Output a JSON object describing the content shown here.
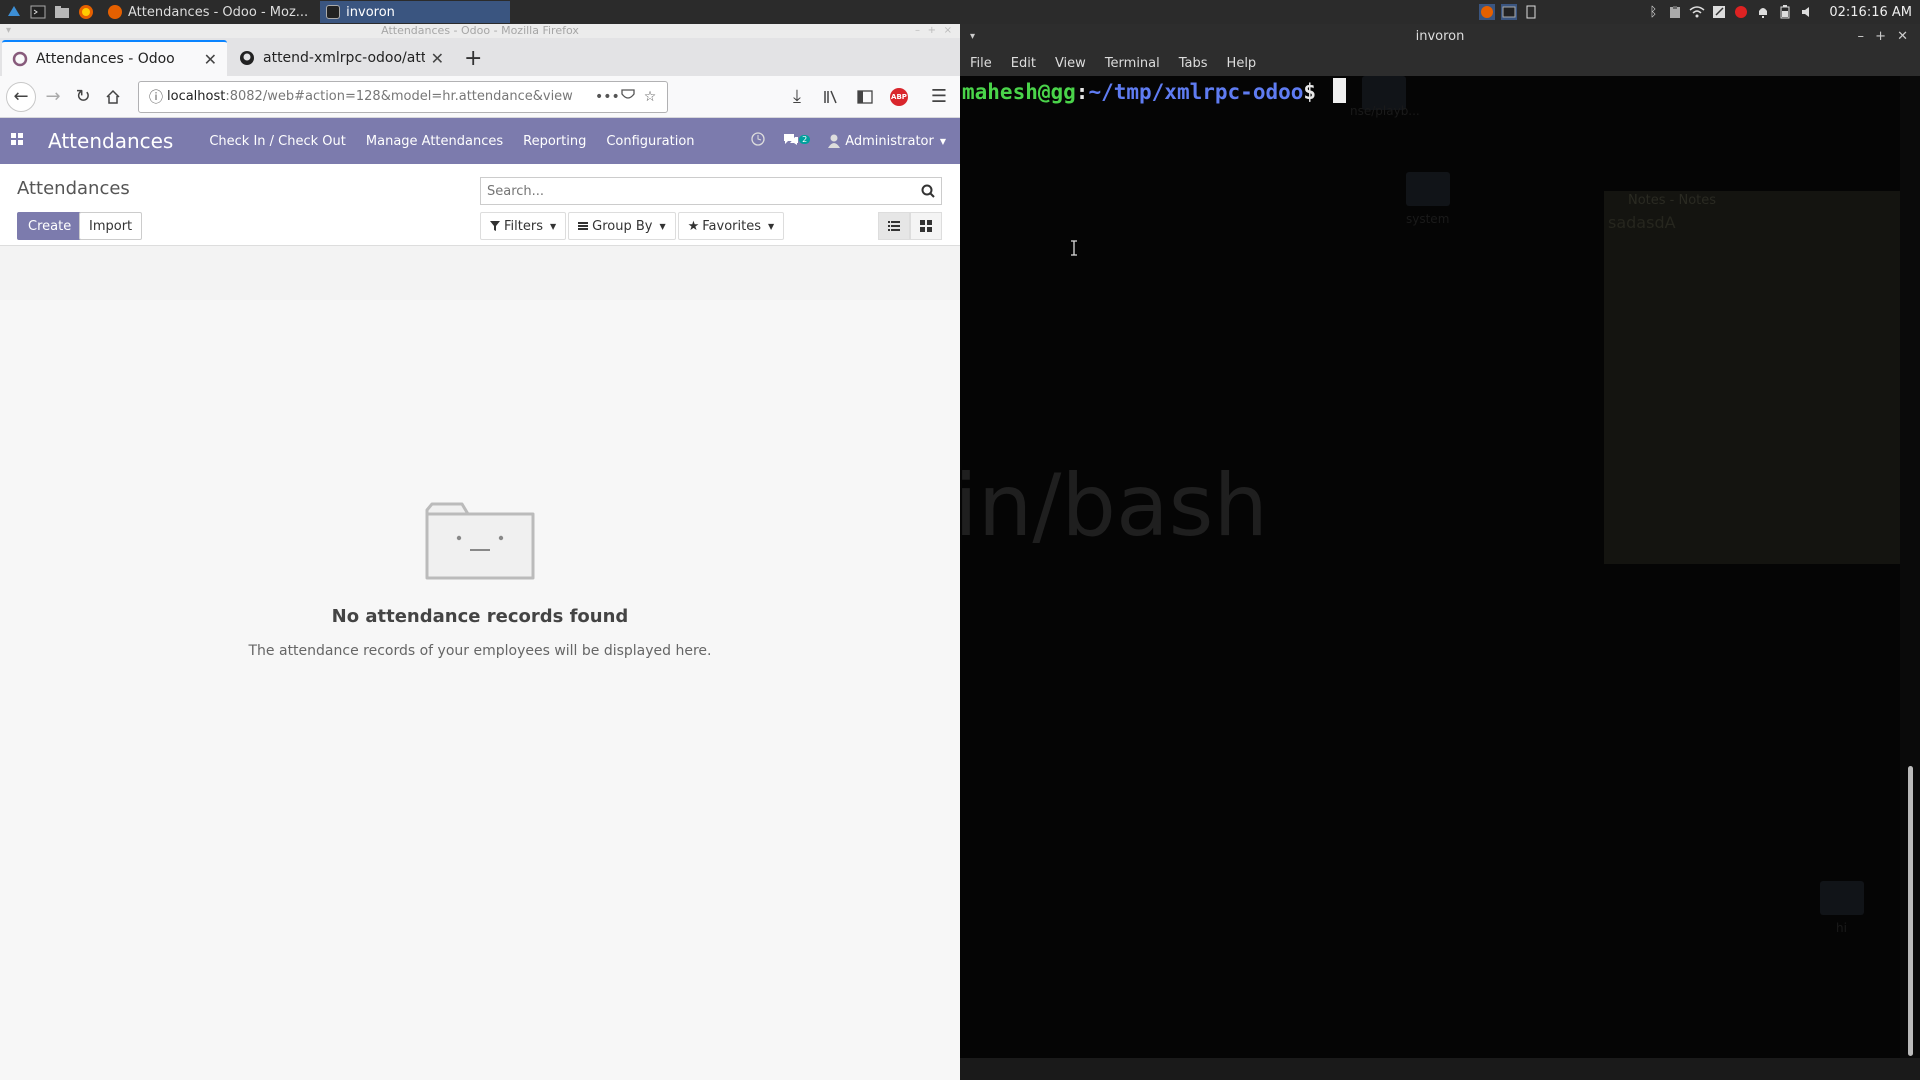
{
  "panel": {
    "tasks": [
      {
        "label": "Attendances - Odoo - Moz..."
      },
      {
        "label": "invoron"
      }
    ],
    "clock": "02:16:16 AM"
  },
  "firefox": {
    "window_title": "Attendances - Odoo - Mozilla Firefox",
    "tabs": [
      {
        "title": "Attendances - Odoo"
      },
      {
        "title": "attend-xmlrpc-odoo/atten"
      }
    ],
    "url_host": "localhost",
    "url_rest": ":8082/web#action=128&model=hr.attendance&view",
    "url_overflow": "•••",
    "abp_label": "ABP"
  },
  "odoo": {
    "app_name": "Attendances",
    "menu": [
      "Check In / Check Out",
      "Manage Attendances",
      "Reporting",
      "Configuration"
    ],
    "chat_badge": "2",
    "user": "Administrator",
    "breadcrumb": "Attendances",
    "create_label": "Create",
    "import_label": "Import",
    "search_placeholder": "Search...",
    "filters_label": "Filters",
    "groupby_label": "Group By",
    "favorites_label": "Favorites",
    "empty_title": "No attendance records found",
    "empty_sub": "The attendance records of your employees will be displayed here."
  },
  "terminal": {
    "title": "invoron",
    "menu": [
      "File",
      "Edit",
      "View",
      "Terminal",
      "Tabs",
      "Help"
    ],
    "prompt_user": "mahesh@gg",
    "prompt_colon": ":",
    "prompt_path": "~/tmp/xmlrpc-odoo",
    "prompt_dollar": "$",
    "bg_ghost_text": "in/bash",
    "bg_notes_title": "Notes - Notes",
    "bg_notes_body": "sadasdA",
    "bg_label_1": "nse/playb...",
    "bg_label_2": "system",
    "bg_label_3": "hi"
  },
  "colors": {
    "odoo_primary": "#7c7bad",
    "terminal_user": "#4ad44a",
    "terminal_path": "#5f7cf2",
    "firefox_tab_accent": "#0a84ff"
  }
}
